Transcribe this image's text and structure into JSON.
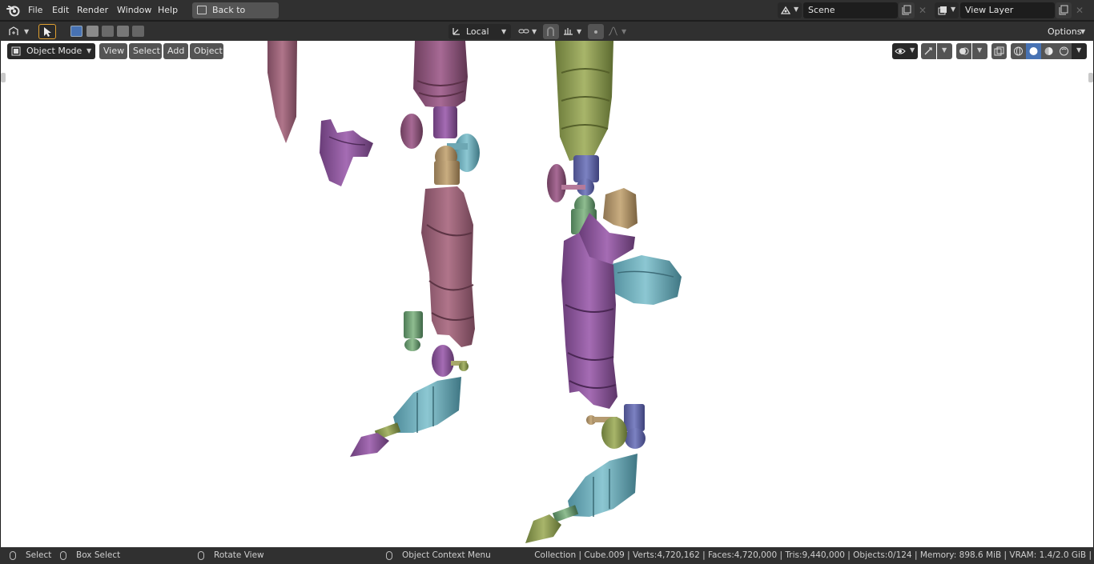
{
  "menu": {
    "items": [
      "File",
      "Edit",
      "Render",
      "Window",
      "Help"
    ],
    "back_button": "Back to Previous"
  },
  "scene": {
    "label": "Scene"
  },
  "view_layer": {
    "label": "View Layer"
  },
  "tool_header": {
    "transform_orientation": "Local",
    "options_label": "Options"
  },
  "viewport": {
    "mode": "Object Mode",
    "menus": [
      "View",
      "Select",
      "Add",
      "Object"
    ]
  },
  "statusbar": {
    "select": "Select",
    "box_select": "Box Select",
    "rotate_view": "Rotate View",
    "context_menu": "Object Context Menu",
    "stats": "Collection | Cube.009 | Verts:4,720,162 | Faces:4,720,000 | Tris:9,440,000 | Objects:0/124 | Memory: 898.6 MiB | VRAM: 1.4/2.0 GiB |"
  },
  "colors": {
    "header_bg": "#303030",
    "field_bg": "#1d1d1d",
    "button_bg": "#545454",
    "accent_blue": "#4772b3",
    "viewport_bg": "#ffffff"
  }
}
